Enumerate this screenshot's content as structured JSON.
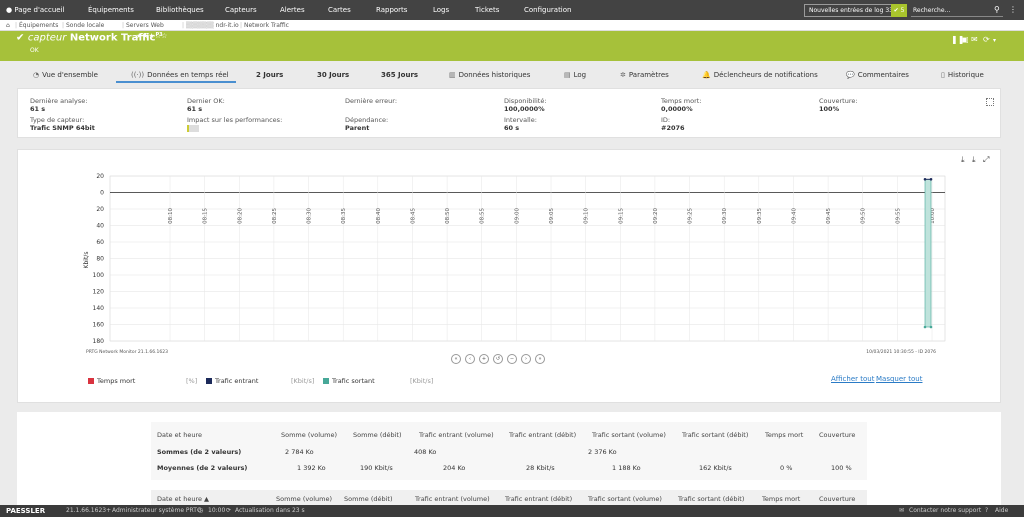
{
  "topnav": {
    "home": "Page d'accueil",
    "items": [
      "Équipements",
      "Bibliothèques",
      "Capteurs",
      "Alertes",
      "Cartes",
      "Rapports",
      "Logs",
      "Tickets",
      "Configuration"
    ],
    "new_log_entries": "Nouvelles entrées de log",
    "new_log_count": "33",
    "green_badge": "5",
    "search_placeholder": "Recherche..."
  },
  "breadcrumb": [
    "Équipements",
    "Sonde locale",
    "Servers Web",
    "ndr-it.io",
    "Network Traffic"
  ],
  "header": {
    "title_prefix": "capteur",
    "title": "Network Traffic",
    "superscript": "P3",
    "stars": "★★★☆☆",
    "status": "OK"
  },
  "tabs": [
    {
      "label": "Vue d'ensemble",
      "icon": "◔"
    },
    {
      "label": "Données en temps réel",
      "icon": "((·))"
    },
    {
      "label": "2 Jours",
      "icon": ""
    },
    {
      "label": "30 Jours",
      "icon": ""
    },
    {
      "label": "365 Jours",
      "icon": ""
    },
    {
      "label": "Données historiques",
      "icon": "▥"
    },
    {
      "label": "Log",
      "icon": "▤"
    },
    {
      "label": "Paramètres",
      "icon": "✲"
    },
    {
      "label": "Déclencheurs de notifications",
      "icon": "🔔"
    },
    {
      "label": "Commentaires",
      "icon": "💬"
    },
    {
      "label": "Historique",
      "icon": "▯"
    }
  ],
  "info": {
    "derniere_analyse_label": "Dernière analyse:",
    "derniere_analyse": "61 s",
    "dernier_ok_label": "Dernier OK:",
    "dernier_ok": "61 s",
    "derniere_erreur_label": "Dernière erreur:",
    "disponibilite_label": "Disponibilité:",
    "disponibilite": "100,0000%",
    "temps_mort_label": "Temps mort:",
    "temps_mort": "0,0000%",
    "couverture_label": "Couverture:",
    "couverture": "100%",
    "type_label": "Type de capteur:",
    "type": "Trafic SNMP 64bit",
    "impact_label": "Impact sur les performances:",
    "dependance_label": "Dépendance:",
    "dependance": "Parent",
    "intervalle_label": "Intervalle:",
    "intervalle": "60 s",
    "id_label": "ID:",
    "id": "#2076"
  },
  "chart_data": {
    "type": "line",
    "ylabel": "Kbit/s",
    "y_ticks": [
      "20",
      "0",
      "20",
      "40",
      "60",
      "80",
      "100",
      "120",
      "140",
      "160",
      "180"
    ],
    "x_ticks": [
      "08:10",
      "08:15",
      "08:20",
      "08:25",
      "08:30",
      "08:35",
      "08:40",
      "08:45",
      "08:50",
      "08:55",
      "09:00",
      "09:05",
      "09:10",
      "09:15",
      "09:20",
      "09:25",
      "09:30",
      "09:35",
      "09:40",
      "09:45",
      "09:50",
      "09:55",
      "10:00"
    ],
    "footer_left": "PRTG Network Monitor 21.1.66.1623",
    "footer_right": "10/03/2021 10:30:55 - ID 2076",
    "series": [
      {
        "name": "Temps mort",
        "unit": "[%]",
        "color": "#d9333f"
      },
      {
        "name": "Trafic entrant",
        "unit": "[Kbit/s]",
        "color": "#1c2a5a"
      },
      {
        "name": "Trafic sortant",
        "unit": "[Kbit/s]",
        "color": "#47a898"
      }
    ]
  },
  "legend_links": {
    "show_all": "Afficher tout",
    "hide_all": "Masquer tout"
  },
  "summary_table": {
    "headers": [
      "Date et heure",
      "Somme (volume)",
      "Somme (débit)",
      "Trafic entrant (volume)",
      "Trafic entrant (débit)",
      "Trafic sortant (volume)",
      "Trafic sortant (débit)",
      "Temps mort",
      "Couverture"
    ],
    "sums_label": "Sommes (de 2 valeurs)",
    "sums": [
      "2 784 Ko",
      "",
      "408 Ko",
      "",
      "2 376 Ko",
      "",
      "",
      ""
    ],
    "avg_label": "Moyennes (de 2 valeurs)",
    "avg": [
      "1 392 Ko",
      "190 Kbit/s",
      "204 Ko",
      "28 Kbit/s",
      "1 188 Ko",
      "162 Kbit/s",
      "0 %",
      "100 %"
    ]
  },
  "data_table_headers": [
    "Date et heure ▲",
    "Somme (volume)",
    "Somme (débit)",
    "Trafic entrant (volume)",
    "Trafic entrant (débit)",
    "Trafic sortant (volume)",
    "Trafic sortant (débit)",
    "Temps mort",
    "Couverture"
  ],
  "footer": {
    "brand": "PAESSLER",
    "version": "21.1.66.1623+",
    "user": "Administrateur système PRTG",
    "time": "10:00",
    "refresh": "Actualisation dans 23 s",
    "contact": "Contacter notre support",
    "help": "Aide"
  }
}
